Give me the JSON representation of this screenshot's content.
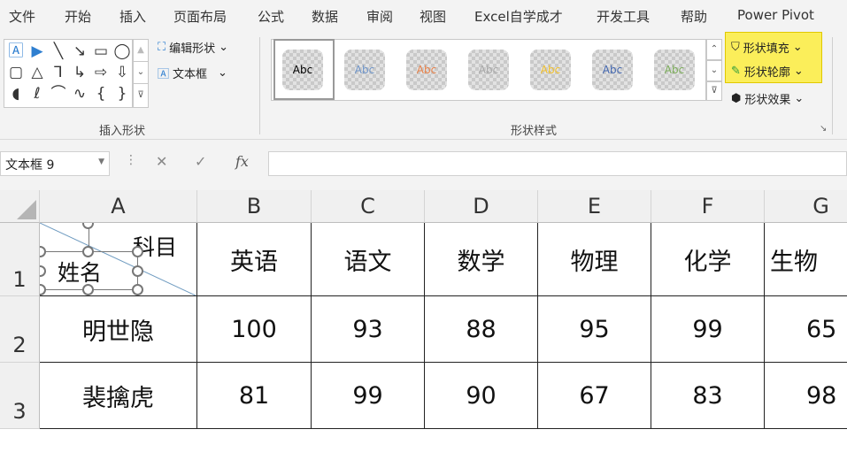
{
  "tabs": [
    "文件",
    "开始",
    "插入",
    "页面布局",
    "公式",
    "数据",
    "审阅",
    "视图",
    "Excel自学成才",
    "开发工具",
    "帮助",
    "Power Pivot"
  ],
  "ribbon": {
    "insert_shapes": {
      "label": "插入形状",
      "edit_shape": "编辑形状",
      "text_box": "文本框"
    },
    "shape_styles": {
      "label": "形状样式",
      "sample": "Abc",
      "colors": [
        "#000000",
        "#6f95c9",
        "#e8824a",
        "#a8a8a8",
        "#f2c12e",
        "#4468b0",
        "#7cad5a"
      ]
    },
    "shape_fill": "形状填充",
    "shape_outline": "形状轮廓",
    "shape_effects": "形状效果",
    "highlight": "#fbee5a"
  },
  "formula_bar": {
    "name_box": "文本框 9",
    "fx": "fx",
    "value": ""
  },
  "sheet": {
    "columns": [
      "A",
      "B",
      "C",
      "D",
      "E",
      "F",
      "G"
    ],
    "rows": [
      "1",
      "2",
      "3"
    ],
    "header_diag": {
      "top_right": "科目",
      "bottom_left": "姓名"
    },
    "subjects": [
      "英语",
      "语文",
      "数学",
      "物理",
      "化学",
      "生物"
    ],
    "data": [
      {
        "name": "明世隐",
        "scores": [
          "100",
          "93",
          "88",
          "95",
          "99",
          "65"
        ]
      },
      {
        "name": "裴擒虎",
        "scores": [
          "81",
          "99",
          "90",
          "67",
          "83",
          "98"
        ]
      }
    ]
  }
}
